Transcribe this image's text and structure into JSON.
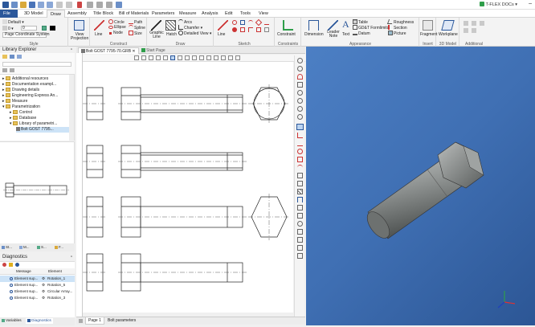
{
  "window": {
    "brand": "T-FLEX DOCs"
  },
  "tabs": [
    "File",
    "3D Model",
    "Draw",
    "Assembly",
    "Title Block",
    "Bill of Materials",
    "Parameters",
    "Measure",
    "Analysis",
    "Edit",
    "Tools",
    "View"
  ],
  "active_tab": "Draw",
  "style_group": {
    "style_value": "Default",
    "layer_value": "0",
    "width_value": "0",
    "coord_system": "Page Coordinate System",
    "label": "Style"
  },
  "ribbon": {
    "projection": "View Projection",
    "construct": {
      "line": "Line",
      "circle": "Circle",
      "ellipse": "Ellipse",
      "node": "Node",
      "path": "Path",
      "spline": "Spline",
      "size": "Size",
      "label": "Construct"
    },
    "draw": {
      "graphic_line": "Graphic Line",
      "hatch": "Hatch",
      "arcs": "Arcs",
      "chamfer": "Chamfer",
      "detailed_view": "Detailed View",
      "label": "Draw"
    },
    "sketch": {
      "line": "Line",
      "label": "Sketch"
    },
    "constraints": {
      "constraint": "Constraint",
      "label": "Constraints"
    },
    "appearance": {
      "dimension": "Dimension",
      "leader_note": "Leader Note",
      "text": "Text",
      "table": "Table",
      "gdt": "GD&T Formlimits",
      "datum": "Datum",
      "roughness": "Roughness",
      "section": "Section",
      "picture": "Picture",
      "label": "Appearance"
    },
    "insert": {
      "fragment": "Fragment",
      "label": "Insert"
    },
    "model3d": {
      "workplane": "Workplane",
      "label": "3D Model"
    },
    "additional": {
      "label": "Additional"
    }
  },
  "library": {
    "title": "Library Explorer",
    "items": [
      "Additional resources",
      "Documentation exampl...",
      "Drawing details",
      "Engineering Express An...",
      "Measure",
      "Parametrization",
      "Control",
      "Database",
      "Library of parametri...",
      "Bolt GOST 7795..."
    ]
  },
  "left_tabs": [
    "St...",
    "M...",
    "S...",
    "F..."
  ],
  "diagnostics": {
    "title": "Diagnostics",
    "col_message": "Message",
    "col_element": "Element",
    "rows": [
      {
        "message": "Element sup...",
        "element": "Rotation_1"
      },
      {
        "message": "Element sup...",
        "element": "Rotation_5"
      },
      {
        "message": "Element sup...",
        "element": "Circular Array..."
      },
      {
        "message": "Element sup...",
        "element": "Rotation_3"
      }
    ],
    "bottom_tabs": [
      "Variables",
      "Diagnostics"
    ]
  },
  "document": {
    "tab_active": "Bolt GOST 7795-70.GRB",
    "tab_other": "Start Page",
    "sheets": [
      "Page 1",
      "Bolt parameters"
    ]
  },
  "colors": {
    "accent": "#2b579a",
    "view3d": "#3f6fb3",
    "brand": "#2f9e4a"
  }
}
